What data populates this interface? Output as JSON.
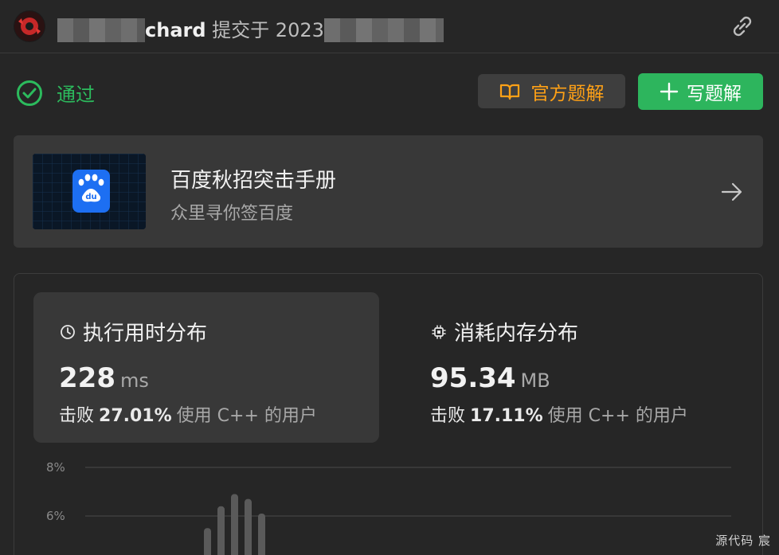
{
  "header": {
    "username": "chard",
    "submitted_text": "提交于 2023"
  },
  "status": {
    "label": "通过",
    "color": "#2cbb5d"
  },
  "buttons": {
    "official_label": "官方题解",
    "write_label": "写题解"
  },
  "promo": {
    "title": "百度秋招突击手册",
    "subtitle": "众里寻你签百度",
    "logo_text": "du"
  },
  "runtime": {
    "title": "执行用时分布",
    "value": "228",
    "unit": "ms",
    "beat_prefix": "击败",
    "percent": "27.01%",
    "suffix": "使用 C++ 的用户"
  },
  "memory": {
    "title": "消耗内存分布",
    "value": "95.34",
    "unit": "MB",
    "beat_prefix": "击败",
    "percent": "17.11%",
    "suffix": "使用 C++ 的用户"
  },
  "chart_data": {
    "type": "bar",
    "y_tick_labels": [
      "8%",
      "6%"
    ],
    "ylim": [
      0,
      9
    ],
    "grid": true,
    "values": [
      5.5,
      6.4,
      6.9,
      6.7,
      6.1
    ],
    "bar_color": "#5a5a5a"
  },
  "footer": {
    "text": "源代码 宸"
  }
}
